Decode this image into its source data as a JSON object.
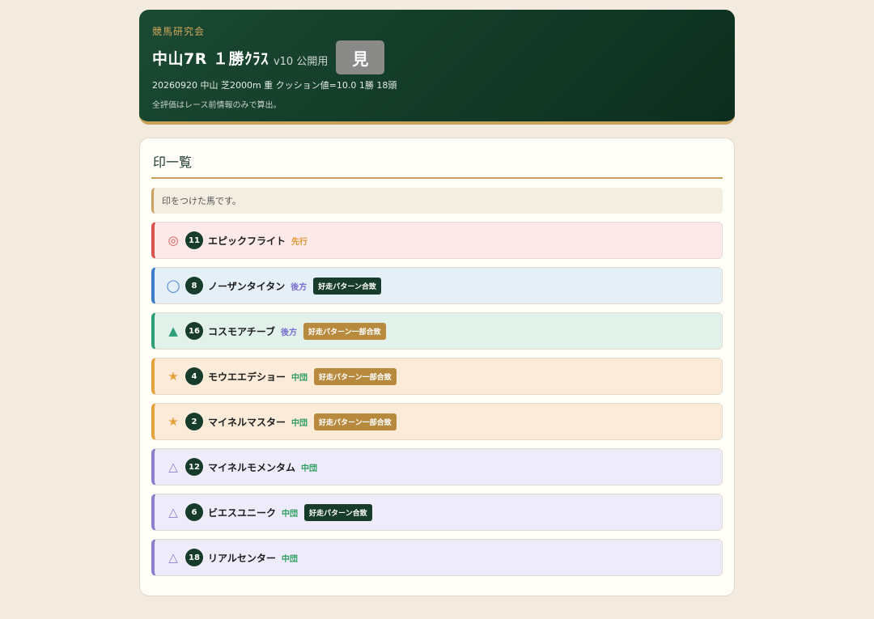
{
  "header": {
    "brand": "競馬研究会",
    "title": "中山7R １勝ｸﾗｽ",
    "version": "v10 公開用",
    "view_button": "見",
    "race_info": "20260920 中山 芝2000m 重 クッション値=10.0 1勝 18頭",
    "note": "全評価はレース前情報のみで算出。"
  },
  "panel": {
    "title": "印一覧",
    "note": "印をつけた馬です。"
  },
  "colors": {
    "honmei_bg": "#fde9e8",
    "honmei_border": "#d9534f",
    "taikou_bg": "#e5eff8",
    "taikou_border": "#3d7cc9",
    "tanana_bg": "#e2f2ea",
    "tanana_border": "#2e9e78",
    "star_bg": "#fbebd8",
    "star_border": "#e5a13a",
    "renka_bg": "#eeebfb",
    "renka_border": "#8b7fd0",
    "badge_dark": "#173c2b",
    "badge_gold": "#b88a3e",
    "style_senkou": "#e0952e",
    "style_koho": "#7a6fd0",
    "style_chudan": "#2e9e60"
  },
  "horses": [
    {
      "mark": "◎",
      "num": "11",
      "name": "エピックフライト",
      "style": "先行",
      "badge": ""
    },
    {
      "mark": "◯",
      "num": "8",
      "name": "ノーザンタイタン",
      "style": "後方",
      "badge": "好走パターン合致"
    },
    {
      "mark": "▲",
      "num": "16",
      "name": "コスモアチーブ",
      "style": "後方",
      "badge": "好走パターン一部合致"
    },
    {
      "mark": "★",
      "num": "4",
      "name": "モウエエデショー",
      "style": "中団",
      "badge": "好走パターン一部合致"
    },
    {
      "mark": "★",
      "num": "2",
      "name": "マイネルマスター",
      "style": "中団",
      "badge": "好走パターン一部合致"
    },
    {
      "mark": "△",
      "num": "12",
      "name": "マイネルモメンタム",
      "style": "中団",
      "badge": ""
    },
    {
      "mark": "△",
      "num": "6",
      "name": "ビエスユニーク",
      "style": "中団",
      "badge": "好走パターン合致"
    },
    {
      "mark": "△",
      "num": "18",
      "name": "リアルセンター",
      "style": "中団",
      "badge": ""
    }
  ]
}
